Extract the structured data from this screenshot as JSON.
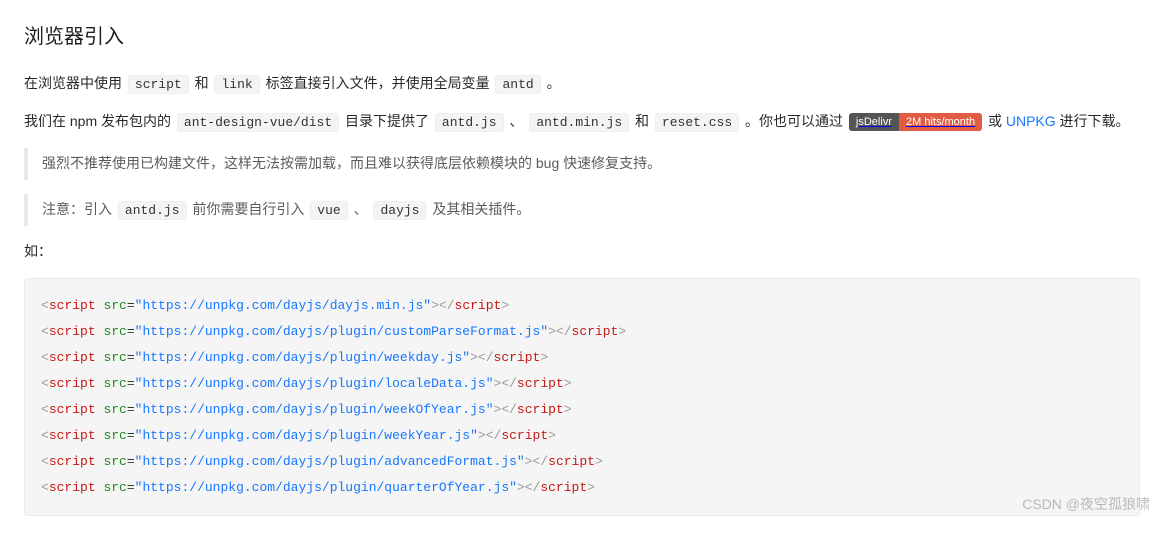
{
  "heading": "浏览器引入",
  "p1": {
    "t1": "在浏览器中使用 ",
    "c1": "script",
    "t2": " 和 ",
    "c2": "link",
    "t3": " 标签直接引入文件，并使用全局变量 ",
    "c3": "antd",
    "t4": " 。"
  },
  "p2": {
    "t1": "我们在 npm 发布包内的 ",
    "c1": "ant-design-vue/dist",
    "t2": " 目录下提供了 ",
    "c2": "antd.js",
    "t3": " 、 ",
    "c3": "antd.min.js",
    "t4": " 和 ",
    "c4": "reset.css",
    "t5": " 。你也可以通过 ",
    "badge_left": "jsDelivr",
    "badge_right": "2M hits/month",
    "t6": " 或 ",
    "link": "UNPKG",
    "t7": " 进行下载。"
  },
  "bq1": "强烈不推荐使用已构建文件，这样无法按需加载，而且难以获得底层依赖模块的 bug 快速修复支持。",
  "bq2": {
    "t1": "注意：引入 ",
    "c1": "antd.js",
    "t2": " 前你需要自行引入 ",
    "c2": "vue",
    "t3": " 、 ",
    "c3": "dayjs",
    "t4": " 及其相关插件。"
  },
  "p3": "如：",
  "code_lines": [
    "https://unpkg.com/dayjs/dayjs.min.js",
    "https://unpkg.com/dayjs/plugin/customParseFormat.js",
    "https://unpkg.com/dayjs/plugin/weekday.js",
    "https://unpkg.com/dayjs/plugin/localeData.js",
    "https://unpkg.com/dayjs/plugin/weekOfYear.js",
    "https://unpkg.com/dayjs/plugin/weekYear.js",
    "https://unpkg.com/dayjs/plugin/advancedFormat.js",
    "https://unpkg.com/dayjs/plugin/quarterOfYear.js"
  ],
  "tag": "script",
  "attr": "src",
  "watermark": "CSDN @夜空孤狼啸"
}
